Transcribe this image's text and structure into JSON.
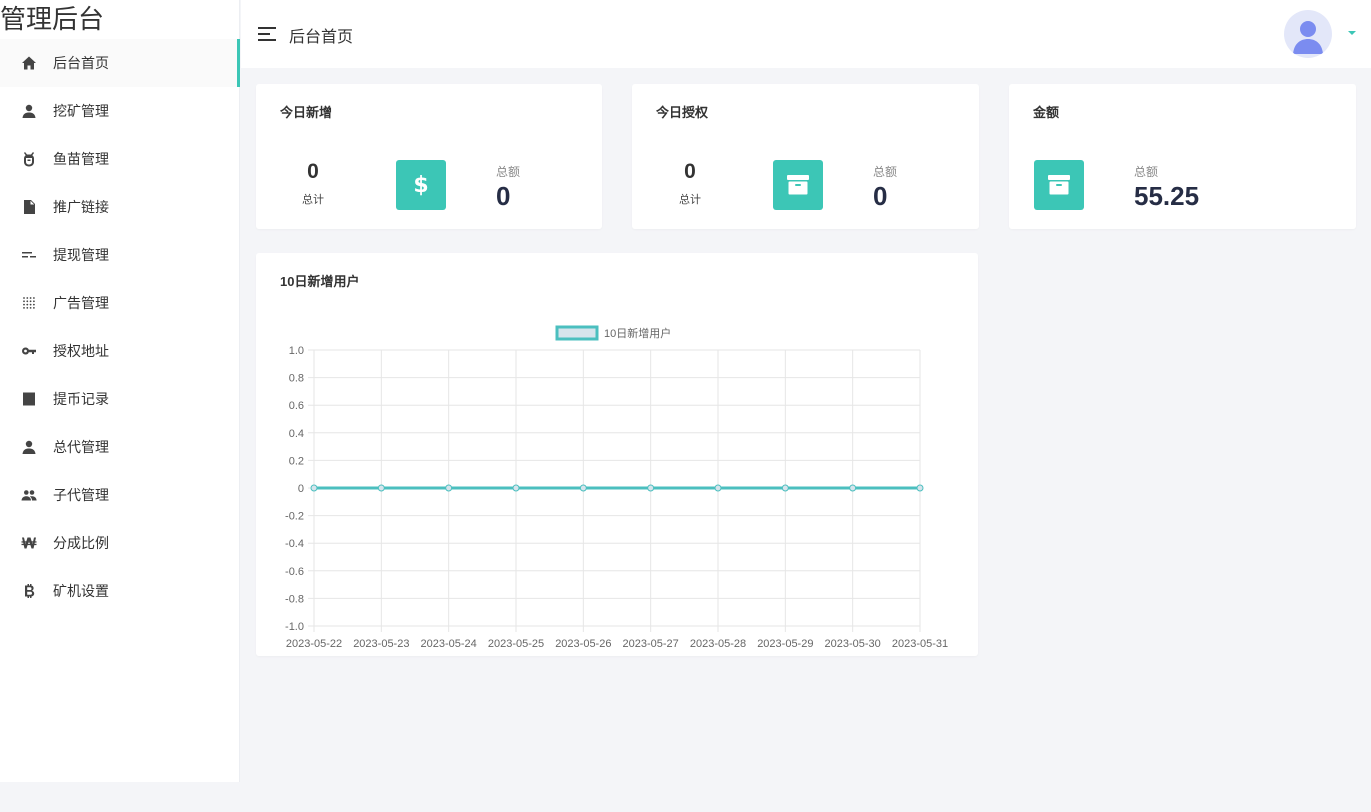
{
  "brand": "管理后台",
  "menu": [
    {
      "label": "后台首页",
      "icon": "home-icon"
    },
    {
      "label": "挖矿管理",
      "icon": "person-icon"
    },
    {
      "label": "鱼苗管理",
      "icon": "bug-icon"
    },
    {
      "label": "推广链接",
      "icon": "document-icon"
    },
    {
      "label": "提现管理",
      "icon": "sort-list-icon"
    },
    {
      "label": "广告管理",
      "icon": "dot-grid-icon"
    },
    {
      "label": "授权地址",
      "icon": "key-icon"
    },
    {
      "label": "提币记录",
      "icon": "receipt-icon"
    },
    {
      "label": "总代管理",
      "icon": "person-icon"
    },
    {
      "label": "子代管理",
      "icon": "people-icon"
    },
    {
      "label": "分成比例",
      "icon": "won-icon"
    },
    {
      "label": "矿机设置",
      "icon": "bitcoin-icon"
    }
  ],
  "header": {
    "title": "后台首页"
  },
  "cards": {
    "today_new": {
      "title": "今日新增",
      "count": "0",
      "count_label": "总计",
      "sum_label": "总额",
      "sum_value": "0"
    },
    "today_auth": {
      "title": "今日授权",
      "count": "0",
      "count_label": "总计",
      "sum_label": "总额",
      "sum_value": "0"
    },
    "amount": {
      "title": "金额",
      "sum_label": "总额",
      "sum_value": "55.25"
    }
  },
  "chart_card": {
    "title": "10日新增用户"
  },
  "colors": {
    "accent": "#3cc6b6",
    "line": "#4bbfbf",
    "legend_fill": "#d6e4ec"
  },
  "chart_data": {
    "type": "line",
    "title": "",
    "xlabel": "",
    "ylabel": "",
    "categories": [
      "2023-05-22",
      "2023-05-23",
      "2023-05-24",
      "2023-05-25",
      "2023-05-26",
      "2023-05-27",
      "2023-05-28",
      "2023-05-29",
      "2023-05-30",
      "2023-05-31"
    ],
    "series": [
      {
        "name": "10日新增用户",
        "values": [
          0,
          0,
          0,
          0,
          0,
          0,
          0,
          0,
          0,
          0
        ]
      }
    ],
    "ylim": [
      -1.0,
      1.0
    ],
    "yticks": [
      "1.0",
      "0.8",
      "0.6",
      "0.4",
      "0.2",
      "0",
      "-0.2",
      "-0.4",
      "-0.6",
      "-0.8",
      "-1.0"
    ],
    "grid": true,
    "legend": "top"
  }
}
